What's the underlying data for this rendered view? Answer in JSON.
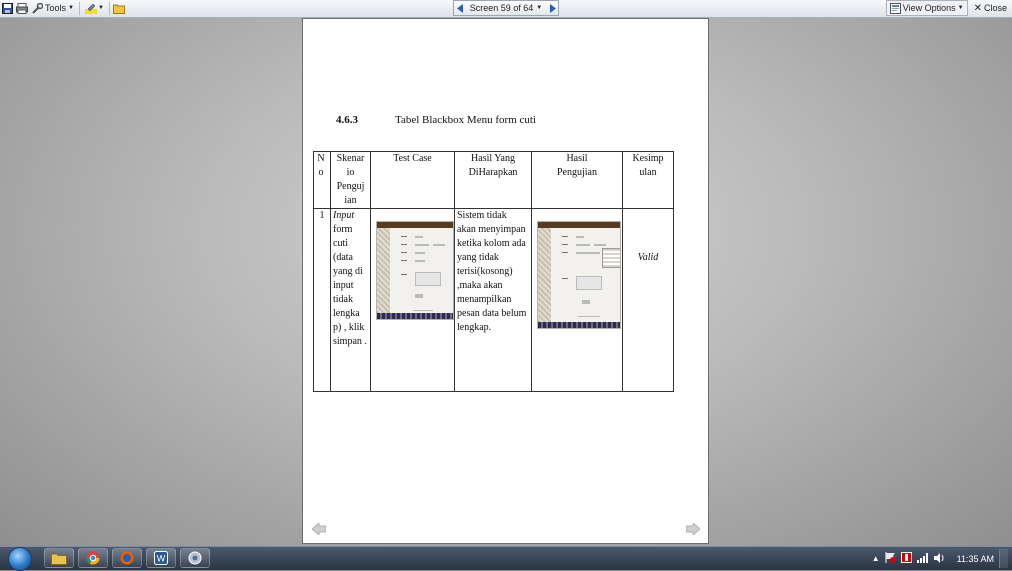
{
  "toolbar": {
    "tools_label": "Tools",
    "screen_label": "Screen 59 of 64",
    "view_options_label": "View Options",
    "close_label": "Close"
  },
  "document": {
    "section_number": "4.6.3",
    "section_title": "Tabel Blackbox Menu form cuti",
    "table": {
      "headers": [
        "N o",
        "Skenar io Penguj ian",
        "Test Case",
        "Hasil Yang DiHarapkan",
        "Hasil Pengujian",
        "Kesimp ulan"
      ],
      "rows": [
        {
          "no": "1",
          "scenario_italic": "Input",
          "scenario_rest": "form cuti (data yang di input tidak lengka p) , klik simpan .",
          "expected": "Sistem tidak akan menyimpan ketika kolom ada yang tidak terisi(kosong) ,maka akan menampilkan pesan data belum lengkap.",
          "conclusion": "Valid"
        }
      ]
    }
  },
  "taskbar": {
    "clock": "11:35 AM",
    "apps": [
      "explorer-icon",
      "chrome-icon",
      "firefox-icon",
      "word-icon",
      "app-icon"
    ]
  }
}
